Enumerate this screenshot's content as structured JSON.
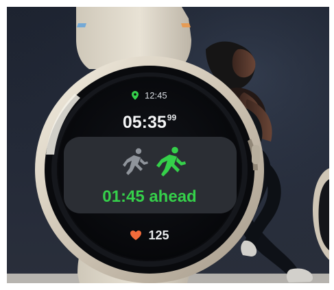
{
  "watch_face": {
    "clock_time": "12:45",
    "elapsed_main": "05:35",
    "elapsed_hundredths": "99",
    "pace_status": "01:45 ahead",
    "heart_rate": "125"
  },
  "icons": {
    "location": "location-pin-icon",
    "ghost_runner": "running-person-icon",
    "live_runner": "running-person-icon",
    "heart": "heart-icon"
  },
  "colors": {
    "accent_green": "#35d04a",
    "heart_orange": "#f26b3a",
    "strap": "#d8d2c4",
    "background": "#1d2330"
  }
}
